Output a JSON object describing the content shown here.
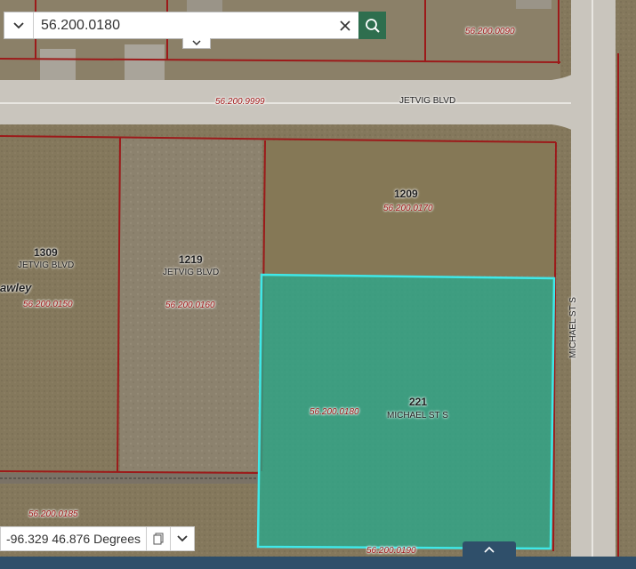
{
  "search": {
    "value": "56.200.0180"
  },
  "coordinates": {
    "readout": "-96.329 46.876 Degrees"
  },
  "streets": {
    "jetvig": "JETVIG BLVD",
    "michael": "MICHAEL ST S",
    "partial": "awley"
  },
  "parcels": [
    {
      "id": "56.200.0090"
    },
    {
      "id": "56.200.9999"
    },
    {
      "id": "56.200.0170",
      "number": "1209"
    },
    {
      "id": "56.200.0150",
      "number": "1309",
      "street": "JETVIG BLVD"
    },
    {
      "id": "56.200.0160",
      "number": "1219",
      "street": "JETVIG BLVD"
    },
    {
      "id": "56.200.0180",
      "number": "221",
      "street": "MICHAEL ST S",
      "selected": true
    },
    {
      "id": "56.200.0185"
    },
    {
      "id": "56.200.0190"
    }
  ],
  "colors": {
    "parcel_line": "#9c1a1a",
    "selection_fill": "#2aa88a",
    "selection_outline": "#3fe8e8",
    "bar": "#2f4f6a",
    "search_button": "#2e6e4e"
  },
  "icons": {
    "dropdown": "chevron-down-icon",
    "clear": "close-icon",
    "search": "search-icon",
    "copy": "copy-icon",
    "expand": "chevron-up-icon"
  }
}
